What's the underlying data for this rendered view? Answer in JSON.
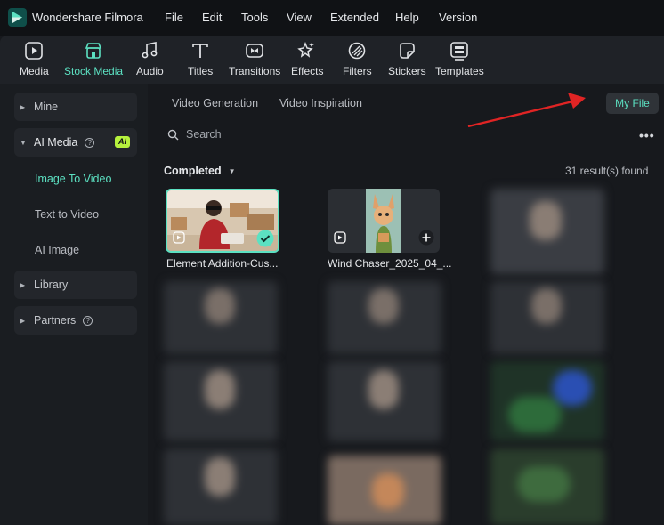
{
  "app": {
    "title": "Wondershare Filmora"
  },
  "menu": [
    "File",
    "Edit",
    "Tools",
    "View",
    "Extended",
    "Help",
    "Version"
  ],
  "toolbar": [
    {
      "label": "Media",
      "icon": "media-icon"
    },
    {
      "label": "Stock Media",
      "icon": "stock-media-icon",
      "active": true
    },
    {
      "label": "Audio",
      "icon": "audio-icon"
    },
    {
      "label": "Titles",
      "icon": "titles-icon"
    },
    {
      "label": "Transitions",
      "icon": "transitions-icon"
    },
    {
      "label": "Effects",
      "icon": "effects-icon"
    },
    {
      "label": "Filters",
      "icon": "filters-icon"
    },
    {
      "label": "Stickers",
      "icon": "stickers-icon"
    },
    {
      "label": "Templates",
      "icon": "templates-icon"
    }
  ],
  "sidebar": {
    "mine": "Mine",
    "ai_media": "AI Media",
    "ai_badge": "AI",
    "sub_items": [
      "Image To Video",
      "Text to Video",
      "AI Image"
    ],
    "library": "Library",
    "partners": "Partners"
  },
  "tabs": {
    "video_generation": "Video Generation",
    "video_inspiration": "Video Inspiration",
    "my_file": "My File"
  },
  "search": {
    "placeholder": "Search"
  },
  "filter": {
    "label": "Completed"
  },
  "results": "31 result(s) found",
  "cards": [
    {
      "name": "Element Addition-Cus..."
    },
    {
      "name": "Wind Chaser_2025_04_..."
    }
  ],
  "colors": {
    "accent": "#5ce1c2",
    "annotation_arrow": "#e02424",
    "ai_badge": "#b6f23d"
  }
}
